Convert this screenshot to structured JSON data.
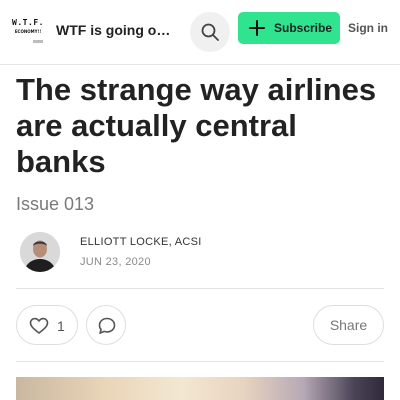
{
  "header": {
    "logo_line1": "W.T.F.",
    "logo_line2": "ECONOMY!!",
    "publication_name": "WTF is going on with the economy",
    "subscribe_label": "Subscribe",
    "signin_label": "Sign in",
    "accent_color": "#2fe38f"
  },
  "post": {
    "title": "The strange way airlines are actually central banks",
    "subtitle": "Issue 013",
    "author": "ELLIOTT LOCKE, ACSI",
    "date": "JUN 23, 2020"
  },
  "actions": {
    "like_count": "1",
    "share_label": "Share"
  },
  "icons": {
    "search": "search-icon",
    "plus": "plus-icon",
    "heart": "heart-icon",
    "comment": "comment-icon"
  }
}
